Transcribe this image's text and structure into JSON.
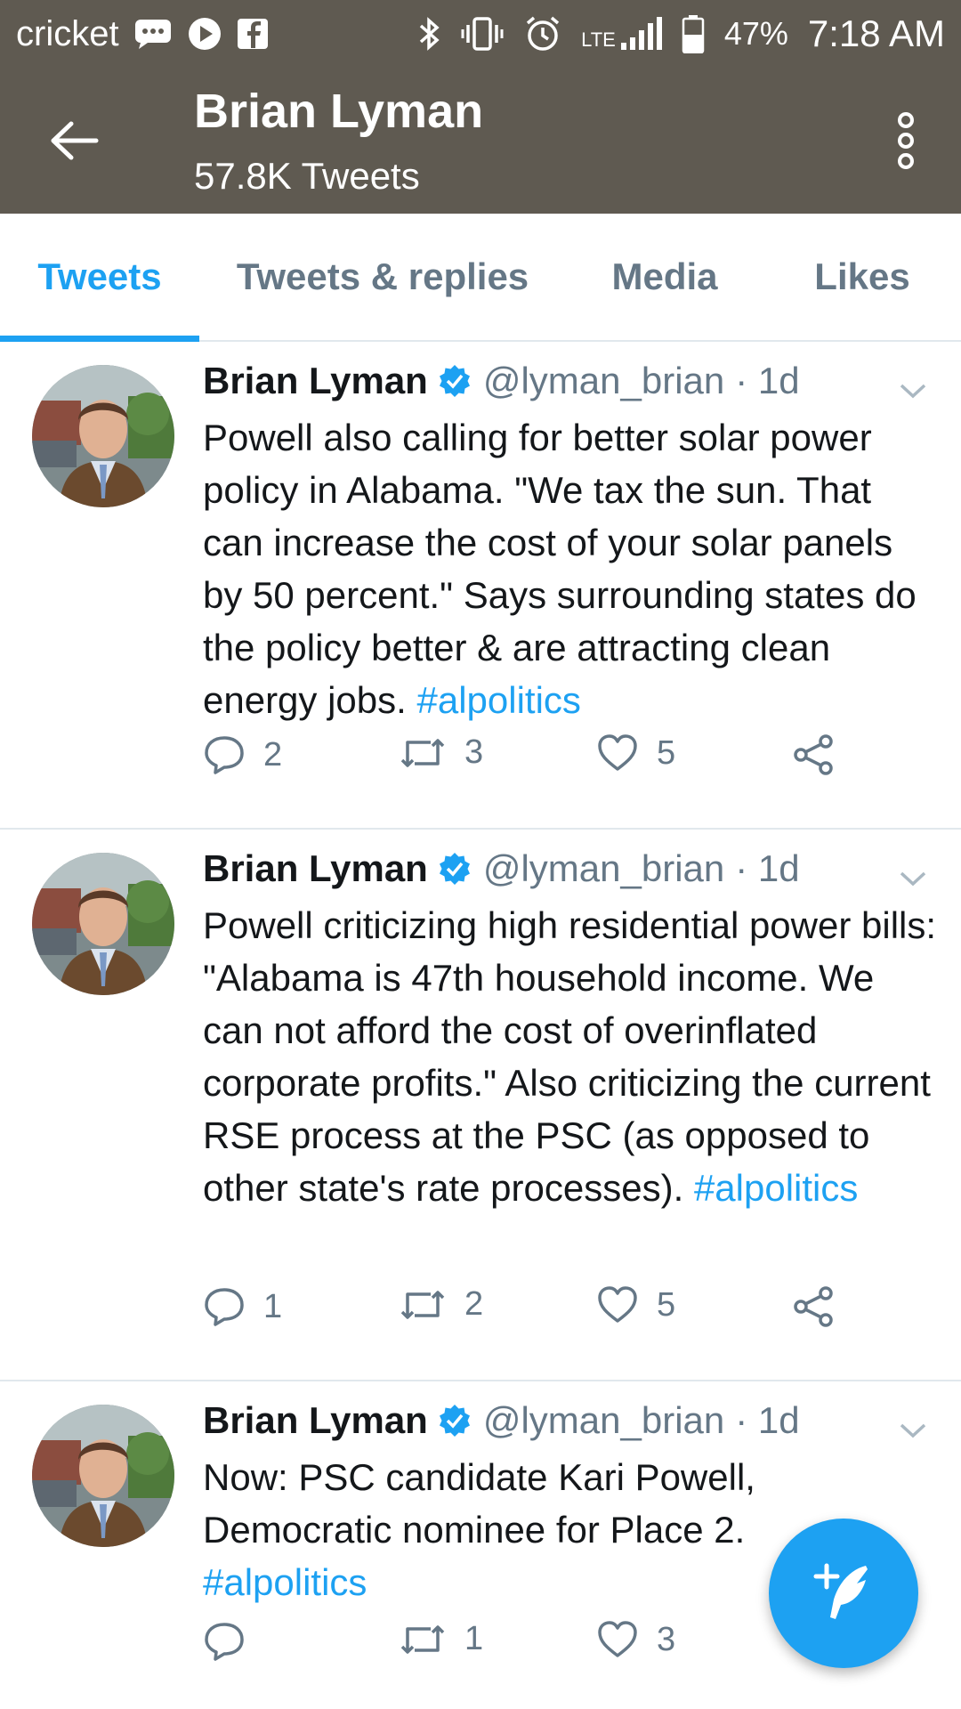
{
  "status_bar": {
    "carrier": "cricket",
    "network": "LTE",
    "battery": "47%",
    "time": "7:18 AM",
    "icons": [
      "message-icon",
      "play-icon",
      "facebook-icon",
      "bluetooth-icon",
      "vibrate-icon",
      "alarm-icon",
      "signal-icon",
      "battery-icon"
    ]
  },
  "header": {
    "name": "Brian Lyman",
    "tweet_count": "57.8K Tweets"
  },
  "tabs": [
    {
      "label": "Tweets",
      "active": true
    },
    {
      "label": "Tweets & replies",
      "active": false
    },
    {
      "label": "Media",
      "active": false
    },
    {
      "label": "Likes",
      "active": false
    }
  ],
  "tweets": [
    {
      "author": "Brian Lyman",
      "handle": "@lyman_brian",
      "time": "· 1d",
      "text": "Powell also calling for better solar power policy in Alabama. \"We tax the sun. That can increase the cost of your solar panels by 50 percent.\" Says surrounding states do the policy better & are attracting clean energy jobs. ",
      "hashtag": "#alpolitics",
      "replies": "2",
      "retweets": "3",
      "likes": "5"
    },
    {
      "author": "Brian Lyman",
      "handle": "@lyman_brian",
      "time": "· 1d",
      "text": "Powell criticizing high residential power bills: \"Alabama is 47th household income. We can not afford the cost of overinflated corporate profits.\" Also criticizing the current RSE process at the PSC (as opposed to other state's rate processes). ",
      "hashtag": "#alpolitics",
      "replies": "1",
      "retweets": "2",
      "likes": "5"
    },
    {
      "author": "Brian Lyman",
      "handle": "@lyman_brian",
      "time": "· 1d",
      "text": "Now: PSC candidate Kari Powell, Democratic nominee for Place 2. ",
      "hashtag": "#alpolitics",
      "replies": "",
      "retweets": "1",
      "likes": "3"
    }
  ],
  "colors": {
    "header_bg": "#5f5a51",
    "accent": "#1da1f2",
    "secondary_text": "#657786"
  }
}
